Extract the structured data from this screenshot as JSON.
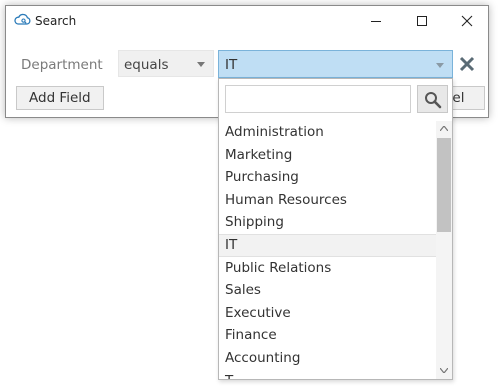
{
  "window": {
    "title": "Search",
    "app_icon": "cloud-search-icon",
    "controls": [
      "minimize-icon",
      "maximize-icon",
      "close-icon"
    ]
  },
  "criteria": {
    "field_label": "Department",
    "operator": {
      "selected": "equals"
    },
    "value": {
      "selected": "IT"
    }
  },
  "buttons": {
    "add_field": "Add Field",
    "cancel_visible": "cel"
  },
  "dropdown": {
    "search_placeholder": "",
    "search_icon": "magnifier-icon",
    "items": [
      {
        "label": "Administration"
      },
      {
        "label": "Marketing"
      },
      {
        "label": "Purchasing"
      },
      {
        "label": "Human Resources"
      },
      {
        "label": "Shipping"
      },
      {
        "label": "IT",
        "selected": true
      },
      {
        "label": "Public Relations"
      },
      {
        "label": "Sales"
      },
      {
        "label": "Executive"
      },
      {
        "label": "Finance"
      },
      {
        "label": "Accounting"
      },
      {
        "label": "T"
      }
    ]
  },
  "colors": {
    "selected_field_bg": "#bfdef4",
    "selected_field_border": "#7ab3da",
    "remove_icon": "#5a6b75"
  }
}
